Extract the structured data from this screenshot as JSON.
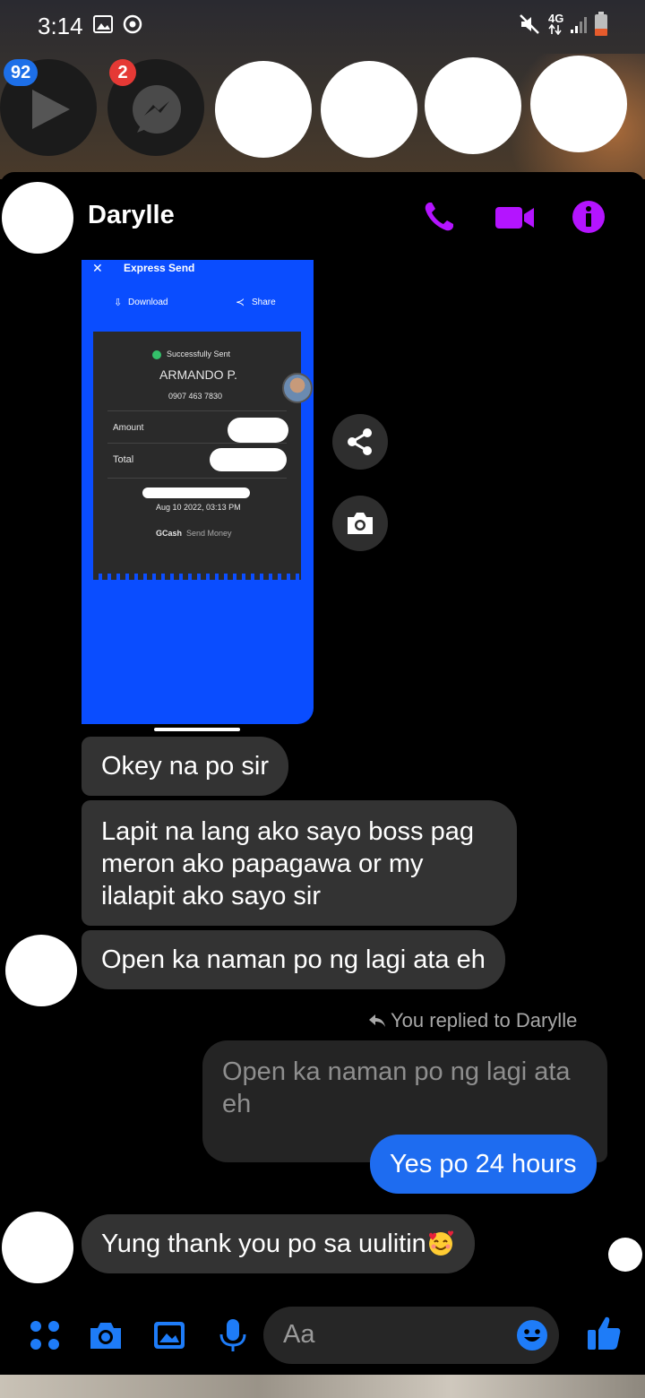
{
  "status_bar": {
    "time": "3:14",
    "network": "4G"
  },
  "chat_heads": {
    "first_badge": "92",
    "second_badge": "2"
  },
  "conversation": {
    "contact_name": "Darylle"
  },
  "shared_image": {
    "header_title": "Express Send",
    "download_label": "Download",
    "share_label": "Share",
    "status": "Successfully Sent",
    "recipient_name": "ARMANDO P.",
    "recipient_number": "0907 463 7830",
    "amount_label": "Amount",
    "total_label": "Total",
    "datetime": "Aug 10 2022, 03:13 PM",
    "footer_brand": "GCash",
    "footer_text": "Send Money"
  },
  "messages": {
    "m1": "Okey na po sir",
    "m2": "Lapit na lang ako sayo boss pag meron ako papagawa or my ilalapit ako sayo sir",
    "m3": "Open ka naman po ng lagi ata eh",
    "reply_note": "You replied to Darylle",
    "quoted": "Open ka naman po ng lagi ata eh",
    "m4": "Yes po 24 hours",
    "m5": "Yung thank you po sa uulitin"
  },
  "composer": {
    "placeholder": "Aa"
  },
  "colors": {
    "accent_purple": "#b414ff",
    "messenger_blue": "#1e6cf0",
    "bubble_gray": "#333333",
    "badge_blue": "#1d6fe8",
    "badge_red": "#e53935"
  }
}
